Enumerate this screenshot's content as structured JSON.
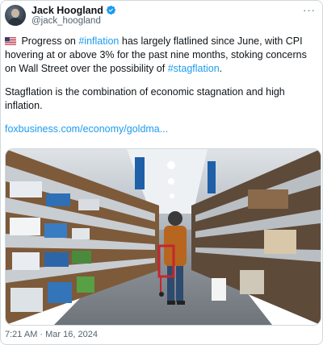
{
  "author": {
    "display_name": "Jack Hoogland",
    "handle": "@jack_hoogland",
    "verified": true
  },
  "tweet": {
    "flag_icon": "us-flag-icon",
    "para1_before": " Progress on ",
    "hashtag1": "#inflation",
    "para1_middle": " has largely flatlined since June, with CPI hovering at or above 3% for the past nine months, stoking concerns on Wall Street over the possibility of ",
    "hashtag2": "#stagflation",
    "para1_after": ".",
    "para2": "Stagflation is the combination of economic stagnation and high inflation.",
    "link": "foxbusiness.com/economy/goldma..."
  },
  "media": {
    "description": "Shopper pushing red cart down warehouse store aisle"
  },
  "timestamp": "7:21 AM · Mar 16, 2024",
  "colors": {
    "link": "#1d9bf0",
    "text": "#0f1419",
    "secondary": "#536471"
  }
}
